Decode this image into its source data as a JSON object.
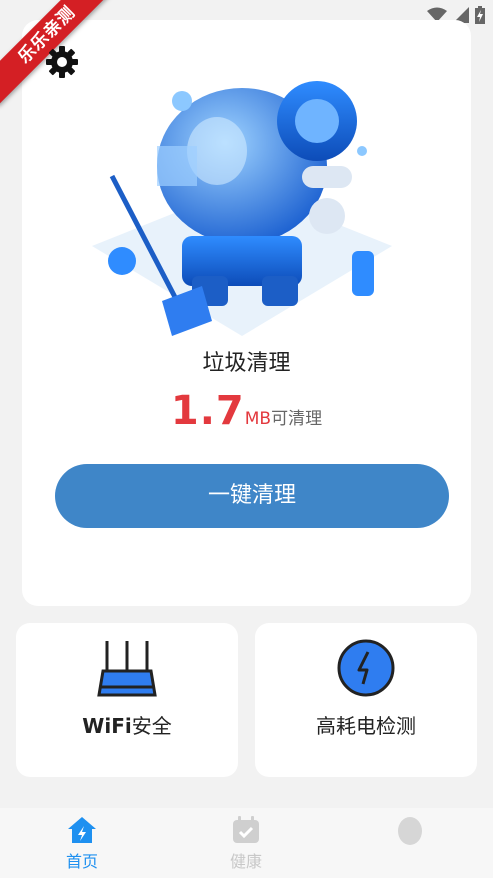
{
  "ribbon": {
    "text": "乐乐亲测"
  },
  "main": {
    "title": "垃圾清理",
    "size_value": "1.7",
    "size_unit": "MB",
    "size_suffix": "可清理",
    "clean_button": "一键清理"
  },
  "features": [
    {
      "label_bold": "WiFi",
      "label_rest": "安全",
      "icon": "router-icon"
    },
    {
      "label": "高耗电检测",
      "icon": "lightning-icon"
    }
  ],
  "nav": [
    {
      "label": "首页",
      "icon": "home-bolt-icon",
      "active": true
    },
    {
      "label": "健康",
      "icon": "calendar-check-icon",
      "active": false
    },
    {
      "label": "",
      "icon": "egg-icon",
      "active": false
    }
  ],
  "colors": {
    "accent": "#3f86c8",
    "size_red": "#e3393e",
    "nav_active": "#1e90f0",
    "ribbon": "#d41f24"
  }
}
